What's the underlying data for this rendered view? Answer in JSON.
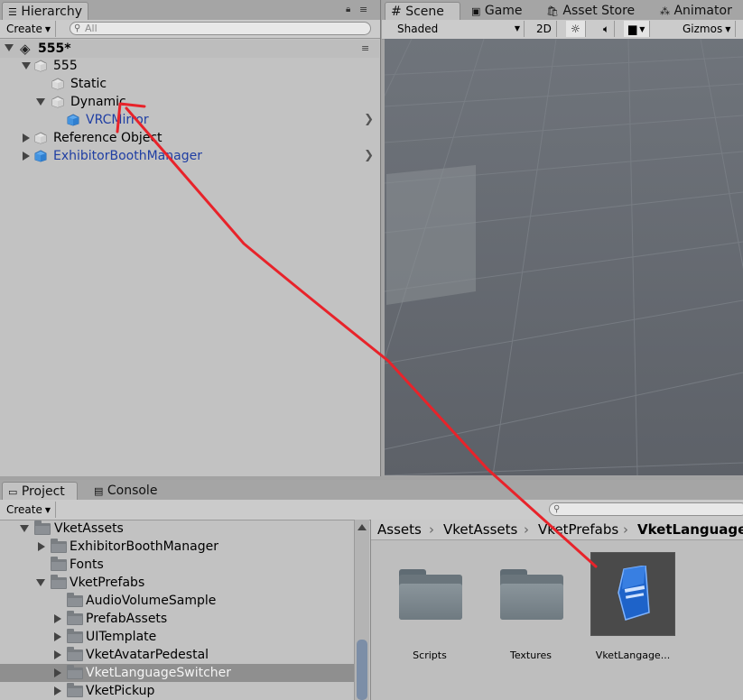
{
  "hierarchy": {
    "tab_label": "Hierarchy",
    "create_label": "Create",
    "search_placeholder": "All",
    "scene_name": "555*",
    "items": [
      {
        "label": "555"
      },
      {
        "label": "Static"
      },
      {
        "label": "Dynamic"
      },
      {
        "label": "VRCMirror"
      },
      {
        "label": "Reference Object"
      },
      {
        "label": "ExhibitorBoothManager"
      }
    ]
  },
  "scene_tabs": {
    "scene": "Scene",
    "game": "Game",
    "asset_store": "Asset Store",
    "animator": "Animator"
  },
  "scene_toolbar": {
    "shading_mode": "Shaded",
    "mode_2d": "2D",
    "gizmos": "Gizmos"
  },
  "bottom_tabs": {
    "project": "Project",
    "console": "Console"
  },
  "project": {
    "create_label": "Create",
    "tree": [
      {
        "label": "VketAssets"
      },
      {
        "label": "ExhibitorBoothManager"
      },
      {
        "label": "Fonts"
      },
      {
        "label": "VketPrefabs"
      },
      {
        "label": "AudioVolumeSample"
      },
      {
        "label": "PrefabAssets"
      },
      {
        "label": "UITemplate"
      },
      {
        "label": "VketAvatarPedestal"
      },
      {
        "label": "VketLanguageSwitcher"
      },
      {
        "label": "VketPickup"
      }
    ],
    "breadcrumb": [
      "Assets",
      "VketAssets",
      "VketPrefabs",
      "VketLanguageSwitcher"
    ],
    "grid_items": [
      {
        "label": "Scripts"
      },
      {
        "label": "Textures"
      },
      {
        "label": "VketLangage..."
      }
    ]
  },
  "colors": {
    "annotation_arrow": "#e8232a",
    "prefab_blue": "#1f3ea3",
    "selection": "#8f8f8f"
  }
}
